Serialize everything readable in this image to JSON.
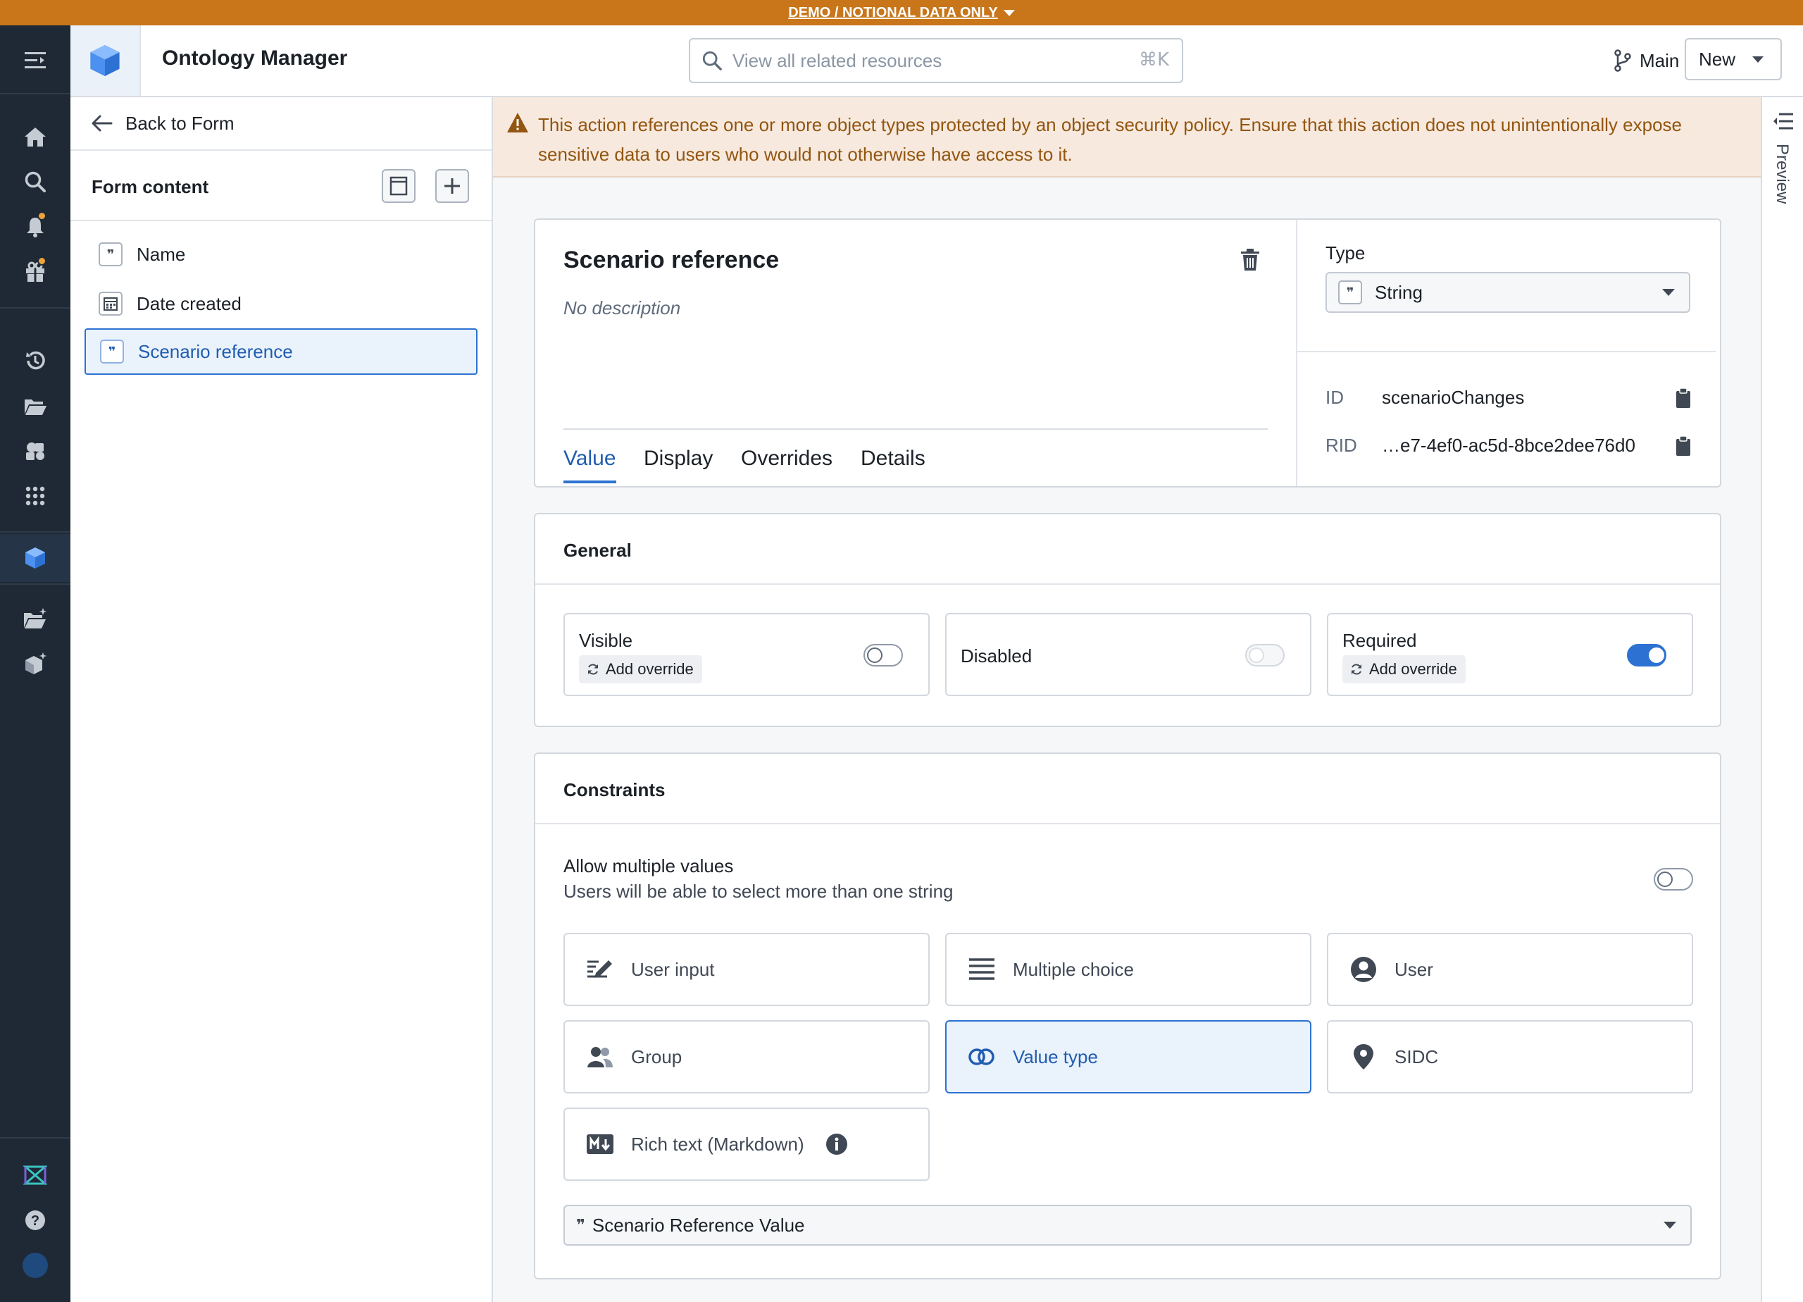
{
  "banner": {
    "text": "DEMO / NOTIONAL DATA ONLY"
  },
  "header": {
    "app_title": "Ontology Manager",
    "search_placeholder": "View all related resources",
    "search_shortcut": "⌘K",
    "branch": "Main",
    "new_label": "New"
  },
  "sidebar": {
    "back_label": "Back to Form",
    "form_content_title": "Form content",
    "items": [
      {
        "label": "Name",
        "icon": "quote-icon"
      },
      {
        "label": "Date created",
        "icon": "calendar-icon"
      },
      {
        "label": "Scenario reference",
        "icon": "quote-icon",
        "selected": true
      }
    ]
  },
  "warning": {
    "text": "This action references one or more object types protected by an object security policy. Ensure that this action does not unintentionally expose sensitive data to users who would not otherwise have access to it."
  },
  "preview": {
    "label": "Preview"
  },
  "property": {
    "title": "Scenario reference",
    "description": "No description",
    "tabs": [
      "Value",
      "Display",
      "Overrides",
      "Details"
    ],
    "active_tab": "Value",
    "type_label": "Type",
    "type_value": "String",
    "id_label": "ID",
    "id_value": "scenarioChanges",
    "rid_label": "RID",
    "rid_value": "…e7-4ef0-ac5d-8bce2dee76d0"
  },
  "general": {
    "title": "General",
    "toggles": [
      {
        "label": "Visible",
        "override": "Add override",
        "on": false
      },
      {
        "label": "Disabled",
        "on": false,
        "disabled": true
      },
      {
        "label": "Required",
        "override": "Add override",
        "on": true
      }
    ]
  },
  "constraints": {
    "title": "Constraints",
    "allow_multiple_title": "Allow multiple values",
    "allow_multiple_sub": "Users will be able to select more than one string",
    "allow_multiple_on": false,
    "options": [
      {
        "label": "User input",
        "icon": "edit-icon"
      },
      {
        "label": "Multiple choice",
        "icon": "list-icon"
      },
      {
        "label": "User",
        "icon": "user-icon"
      },
      {
        "label": "Group",
        "icon": "people-icon"
      },
      {
        "label": "Value type",
        "icon": "value-type-icon",
        "selected": true
      },
      {
        "label": "SIDC",
        "icon": "map-marker-icon"
      },
      {
        "label": "Rich text (Markdown)",
        "icon": "markdown-icon"
      }
    ],
    "value_type_select": "Scenario Reference Value"
  },
  "colors": {
    "banner": "#c87619",
    "rail": "#1f2935",
    "accent": "#2d72d2",
    "warning_bg": "#f7e9de",
    "warning_text": "#935610"
  }
}
